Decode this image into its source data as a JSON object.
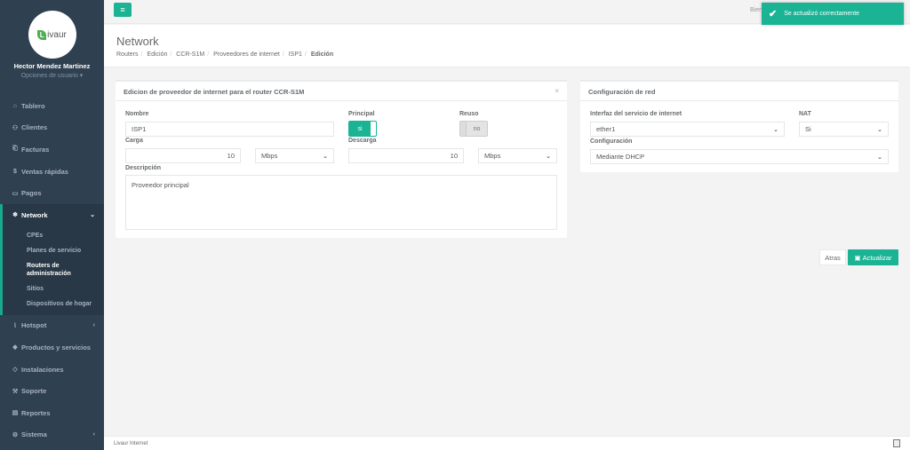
{
  "brand": {
    "logo_letter": "L",
    "logo_text": "ivaur"
  },
  "user": {
    "name": "Hector Mendez Martinez",
    "options": "Opciones de usuario ▾"
  },
  "sidebar": {
    "items": [
      {
        "label": "Tablero",
        "icon": "⌂"
      },
      {
        "label": "Clientes",
        "icon": "⚇"
      },
      {
        "label": "Facturas",
        "icon": "⎗"
      },
      {
        "label": "Ventas rápidas",
        "icon": "$"
      },
      {
        "label": "Pagos",
        "icon": "▭"
      },
      {
        "label": "Network",
        "icon": "❄",
        "arrow": "⌄"
      },
      {
        "label": "Hotspot",
        "icon": "⌇",
        "arrow": "‹"
      },
      {
        "label": "Productos y servicios",
        "icon": "◆"
      },
      {
        "label": "Instalaciones",
        "icon": "◇"
      },
      {
        "label": "Soporte",
        "icon": "⚒"
      },
      {
        "label": "Reportes",
        "icon": "▤"
      },
      {
        "label": "Sistema",
        "icon": "⚙",
        "arrow": "‹"
      }
    ],
    "network_sub": [
      "CPEs",
      "Planes de servicio",
      "Routers de administración",
      "Sitios",
      "Dispositivos de hogar"
    ]
  },
  "topbar": {
    "menu_icon": "≡",
    "welcome": "Bien"
  },
  "toast": {
    "check": "✔",
    "message": "Se actualizó correctamente"
  },
  "page": {
    "title": "Network",
    "breadcrumb": [
      "Routers",
      "Edición",
      "CCR-S1M",
      "Proveedores de internet",
      "ISP1",
      "Edición"
    ]
  },
  "form": {
    "title": "Edicion de proveedor de internet para el router CCR-S1M",
    "close": "×",
    "nombre_label": "Nombre",
    "nombre_value": "ISP1",
    "principal_label": "Principal",
    "principal_value": "si",
    "reuso_label": "Reuso",
    "reuso_value": "no",
    "carga_label": "Carga",
    "carga_value": "10",
    "carga_unit": "Mbps",
    "descarga_label": "Descarga",
    "descarga_value": "10",
    "descarga_unit": "Mbps",
    "descripcion_label": "Descripción",
    "descripcion_value": "Proveedor principal"
  },
  "net": {
    "title": "Configuración de red",
    "interfaz_label": "Interfaz del servicio de internet",
    "interfaz_value": "ether1",
    "nat_label": "NAT",
    "nat_value": "Si",
    "config_label": "Configuración",
    "config_value": "Mediante DHCP"
  },
  "actions": {
    "back": "Atras",
    "update_icon": "▣",
    "update": "Actualizar"
  },
  "footer": {
    "text": "Livaur Internet"
  },
  "chevron": "⌄",
  "colors": {
    "accent": "#1ab394",
    "sidebar": "#2f4050"
  }
}
